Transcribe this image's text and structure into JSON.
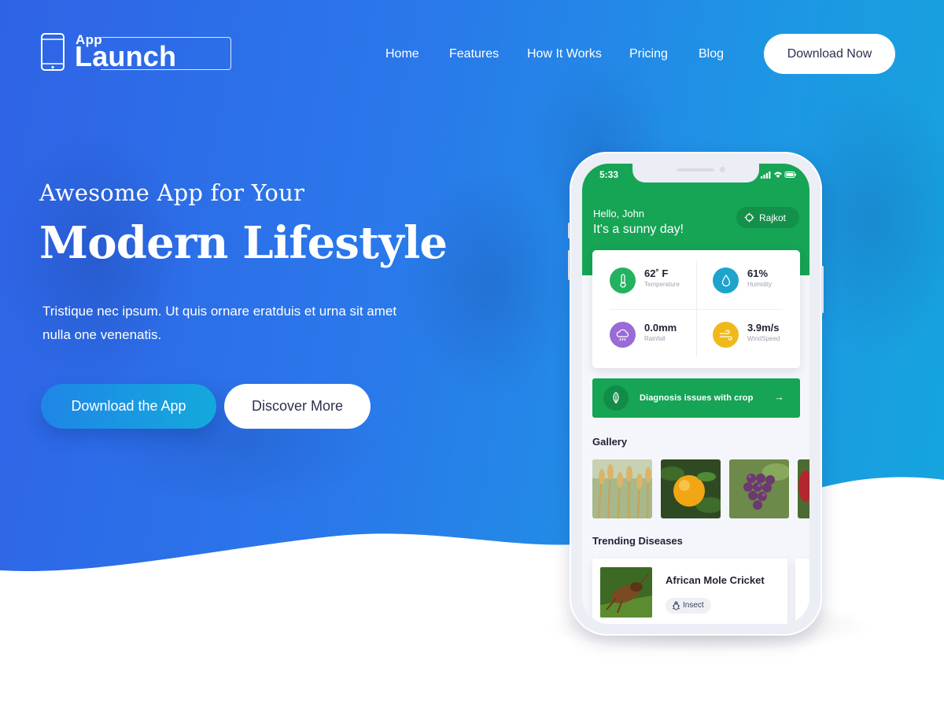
{
  "brand": {
    "app_label": "App",
    "name": "Launch"
  },
  "nav": {
    "items": [
      {
        "label": "Home"
      },
      {
        "label": "Features"
      },
      {
        "label": "How It Works"
      },
      {
        "label": "Pricing"
      },
      {
        "label": "Blog"
      }
    ],
    "cta_label": "Download Now"
  },
  "hero": {
    "subtitle": "Awesome App for Your",
    "title": "Modern Lifestyle",
    "description": "Tristique nec ipsum. Ut quis ornare eratduis et urna sit amet nulla one venenatis.",
    "primary_button": "Download the App",
    "secondary_button": "Discover More"
  },
  "phone": {
    "status_time": "5:33",
    "greeting_name": "Hello, John",
    "greeting_message": "It's a sunny day!",
    "location": "Rajkot",
    "weather": [
      {
        "value": "62˚ F",
        "label": "Temperature",
        "icon": "thermometer-icon",
        "color": "#23b25f"
      },
      {
        "value": "61%",
        "label": "Humidity",
        "icon": "droplet-icon",
        "color": "#1ea4cc"
      },
      {
        "value": "0.0mm",
        "label": "Rainfall",
        "icon": "rain-cloud-icon",
        "color": "#9a6ad6"
      },
      {
        "value": "3.9m/s",
        "label": "WindSpeed",
        "icon": "wind-icon",
        "color": "#efb91a"
      }
    ],
    "diagnosis_label": "Diagnosis issues with crop",
    "gallery_title": "Gallery",
    "gallery": [
      {
        "name": "wheat-photo"
      },
      {
        "name": "orange-photo"
      },
      {
        "name": "grapes-photo"
      },
      {
        "name": "red-fruit-photo"
      }
    ],
    "trending_title": "Trending Diseases",
    "diseases": [
      {
        "name": "African Mole Cricket",
        "tag": "Insect"
      }
    ]
  },
  "colors": {
    "gradient_start": "#2f63e6",
    "gradient_end": "#14a6dc",
    "app_green": "#16a455",
    "dark_text": "#2b3150"
  }
}
